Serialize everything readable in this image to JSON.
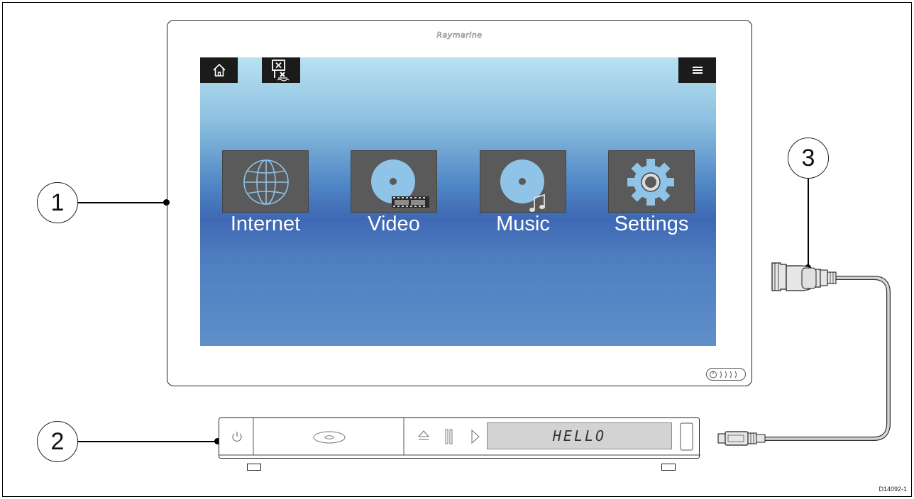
{
  "display": {
    "brand": "Raymarine",
    "tiles": [
      {
        "label": "Internet",
        "icon": "globe-icon"
      },
      {
        "label": "Video",
        "icon": "disc-film-icon"
      },
      {
        "label": "Music",
        "icon": "disc-music-note-icon"
      },
      {
        "label": "Settings",
        "icon": "gear-icon"
      }
    ],
    "toolbar_icons": [
      "home-icon",
      "man-overboard-icon",
      "hamburger-menu-icon"
    ]
  },
  "player": {
    "lcd_text": "HELLO",
    "controls": [
      "power-icon",
      "disc-slot-icon",
      "eject-icon",
      "pause-icon",
      "play-icon"
    ]
  },
  "callouts": [
    "1",
    "2",
    "3"
  ],
  "document_id": "D14092-1",
  "colors": {
    "screen_top": "#b9e1f1",
    "screen_mid": "#3e68b4",
    "tile_bg": "#5a5a5a",
    "icon_blue": "#8fc3e8",
    "lcd_bg": "#d3d3d3"
  }
}
